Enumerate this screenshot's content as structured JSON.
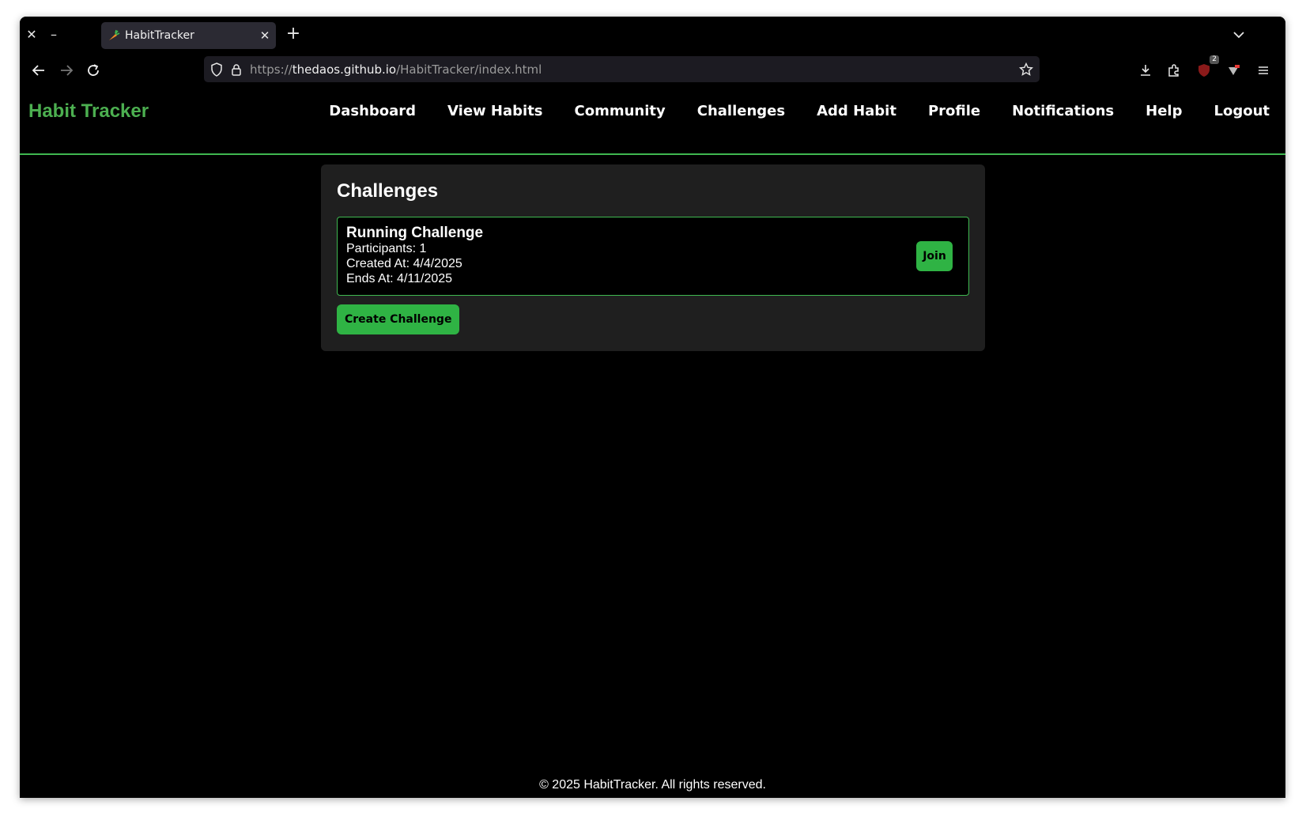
{
  "browser": {
    "tab_title": "HabitTracker",
    "url_scheme": "https://",
    "url_host": "thedaos.github.io",
    "url_path": "/HabitTracker/index.html",
    "extension_badge": "2"
  },
  "site": {
    "logo": "Habit Tracker",
    "nav": [
      "Dashboard",
      "View Habits",
      "Community",
      "Challenges",
      "Add Habit",
      "Profile",
      "Notifications",
      "Help",
      "Logout"
    ],
    "accent_color": "#3fb850"
  },
  "challenges": {
    "heading": "Challenges",
    "items": [
      {
        "name": "Running Challenge",
        "participants": "Participants: 1",
        "created": "Created At: 4/4/2025",
        "ends": "Ends At: 4/11/2025",
        "join_label": "Join"
      }
    ],
    "create_label": "Create Challenge"
  },
  "footer": {
    "text": "© 2025 HabitTracker. All rights reserved."
  }
}
